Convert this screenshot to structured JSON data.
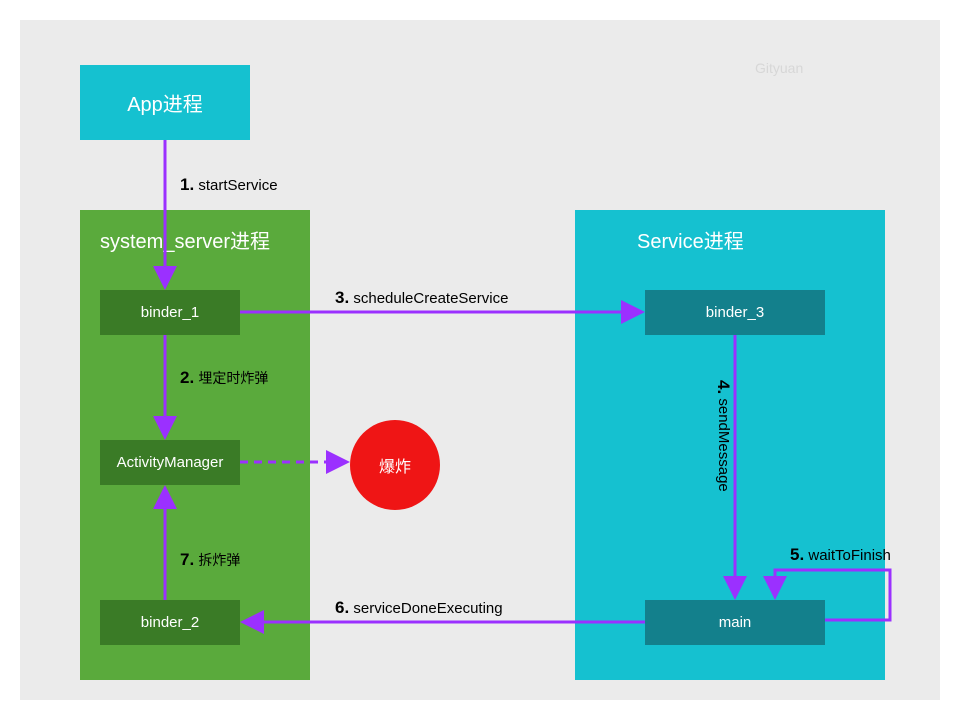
{
  "watermark": "Gityuan",
  "colors": {
    "cyan": "#15c1d0",
    "green": "#5aaa3c",
    "dark_green": "#3a7b26",
    "teal": "#13808c",
    "red": "#ef1515",
    "purple": "#9b30ff",
    "grey": "#ebebeb"
  },
  "app_process": {
    "title": "App进程"
  },
  "system_server": {
    "title": "system_server进程",
    "binder_1": "binder_1",
    "activity_manager": "ActivityManager",
    "binder_2": "binder_2"
  },
  "service_process": {
    "title": "Service进程",
    "binder_3": "binder_3",
    "main": "main"
  },
  "explode": {
    "label": "爆炸"
  },
  "steps": {
    "s1": {
      "num": "1.",
      "text": "startService"
    },
    "s2": {
      "num": "2.",
      "text": "埋定时炸弹"
    },
    "s3": {
      "num": "3.",
      "text": "scheduleCreateService"
    },
    "s4": {
      "num": "4.",
      "text": "sendMessage"
    },
    "s5": {
      "num": "5.",
      "text": "waitToFinish"
    },
    "s6": {
      "num": "6.",
      "text": "serviceDoneExecuting"
    },
    "s7": {
      "num": "7.",
      "text": "拆炸弹"
    }
  }
}
